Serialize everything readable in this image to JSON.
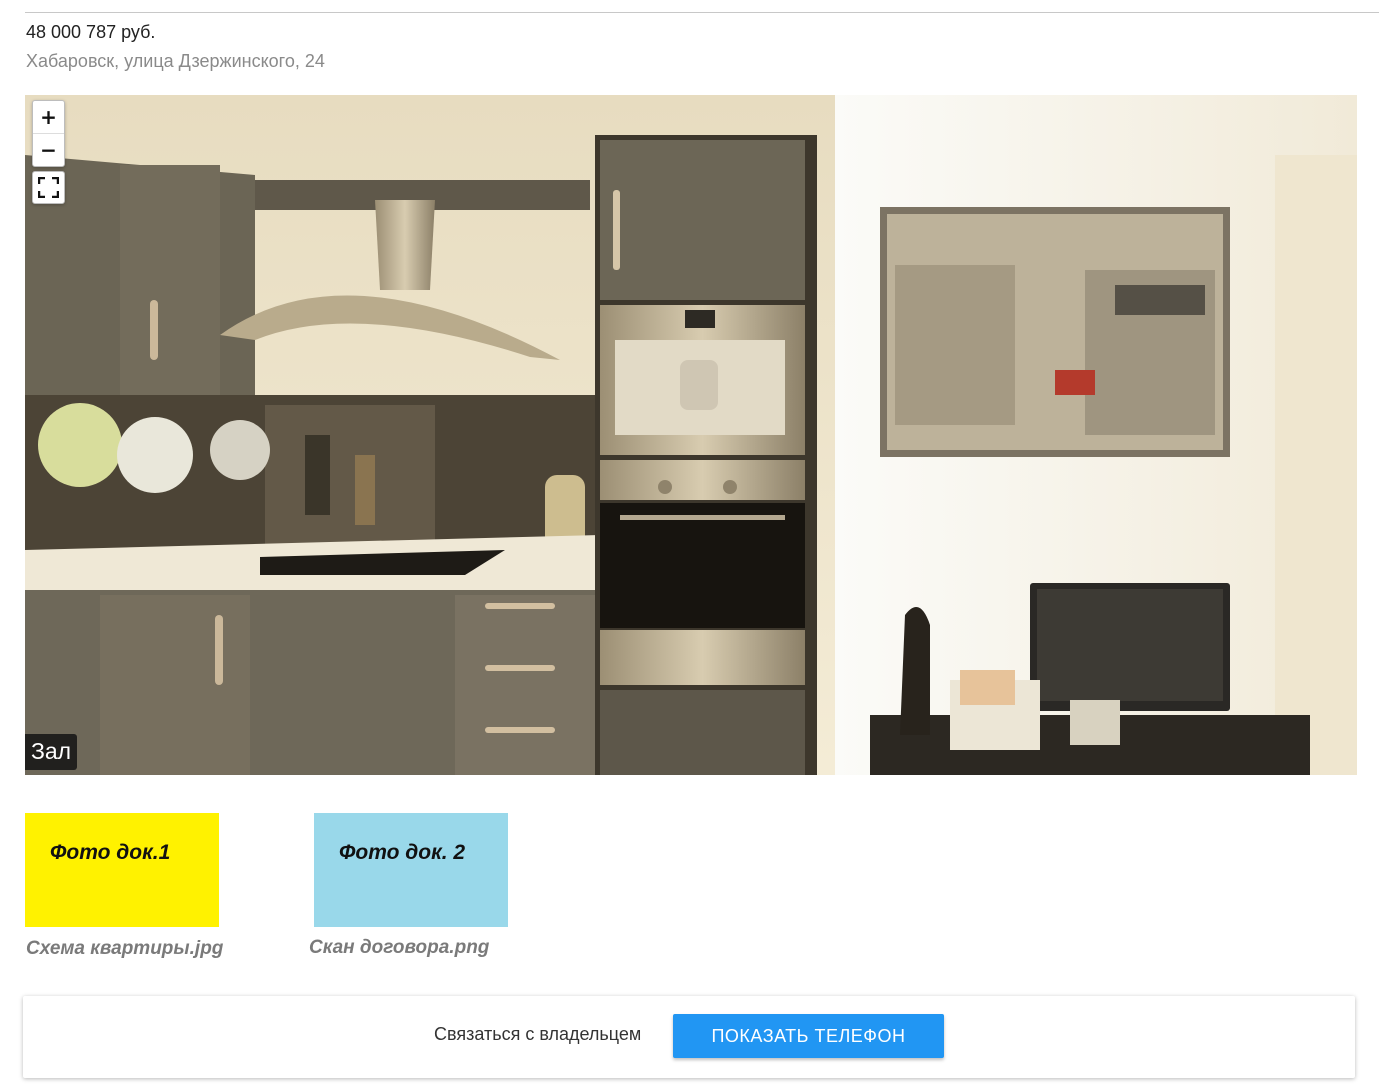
{
  "listing": {
    "price": "48 000 787 руб.",
    "address": "Хабаровск, улица Дзержинского, 24"
  },
  "viewer": {
    "zoom_in_label": "+",
    "zoom_out_label": "−",
    "fullscreen_icon": "fullscreen-icon",
    "room_label": "Зал"
  },
  "documents": [
    {
      "thumb_text": "Фото док.1",
      "caption": "Схема квартиры.jpg",
      "color": "#fff200"
    },
    {
      "thumb_text": "Фото док. 2",
      "caption": "Скан договора.png",
      "color": "#99d8ea"
    }
  ],
  "contact": {
    "text": "Связаться с владельцем",
    "button_label": "ПОКАЗАТЬ ТЕЛЕФОН",
    "button_color": "#2196f3"
  }
}
